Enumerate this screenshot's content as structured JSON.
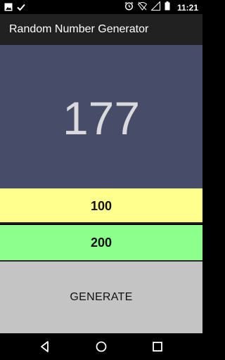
{
  "status_bar": {
    "time": "11:21",
    "left_icons": [
      "image-icon",
      "check-icon"
    ],
    "right_icons": [
      "alarm-icon",
      "wifi-off-icon",
      "signal-icon",
      "battery-icon"
    ]
  },
  "app_bar": {
    "title": "Random Number Generator"
  },
  "result": {
    "value": "177"
  },
  "range": {
    "min_value": "100",
    "max_value": "200",
    "min_color": "#ffff8d",
    "max_color": "#8dff8d"
  },
  "generate": {
    "label": "GENERATE"
  },
  "nav_bar": {
    "buttons": [
      "back-icon",
      "home-icon",
      "recents-icon"
    ]
  },
  "colors": {
    "result_background": "#474d68",
    "button_background": "#c4c4c4",
    "app_bar_background": "#212121"
  }
}
